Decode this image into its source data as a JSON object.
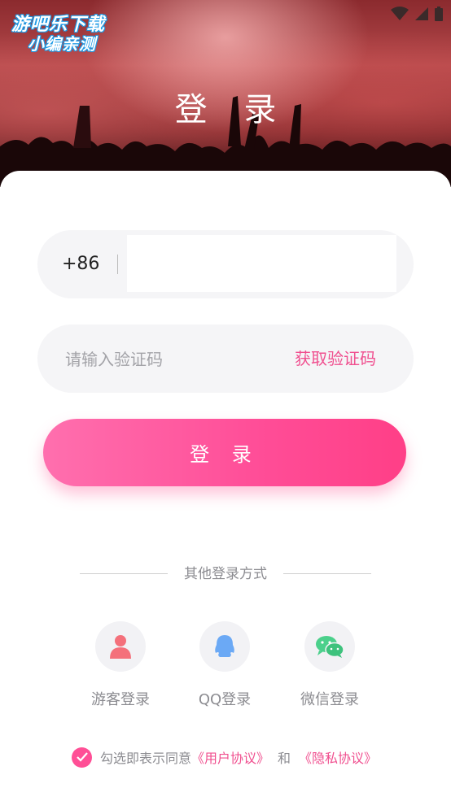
{
  "hero": {
    "title": "登 录"
  },
  "watermark": {
    "line1": "游吧乐下载",
    "line2": "小编亲测"
  },
  "phone": {
    "country_code": "+86",
    "value": ""
  },
  "code": {
    "placeholder": "请输入验证码",
    "get_code_label": "获取验证码"
  },
  "login": {
    "button_label": "登 录"
  },
  "other_login": {
    "title": "其他登录方式",
    "options": [
      {
        "label": "游客登录",
        "icon": "guest-user-icon"
      },
      {
        "label": "QQ登录",
        "icon": "qq-penguin-icon"
      },
      {
        "label": "微信登录",
        "icon": "wechat-icon"
      }
    ]
  },
  "agreement": {
    "prefix": "勾选即表示同意",
    "user_agreement": "《用户协议》",
    "and": "和",
    "privacy_agreement": "《隐私协议》",
    "checked": true
  },
  "colors": {
    "accent": "#ff4f96",
    "link": "#f04f8f",
    "field_bg": "#f5f5f7"
  }
}
